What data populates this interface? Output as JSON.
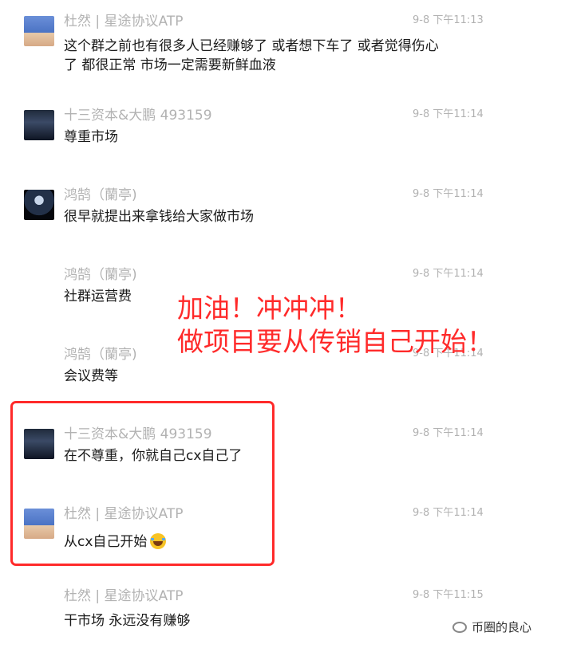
{
  "messages": [
    {
      "sender": "杜然 | 星途协议ATP",
      "time": "9-8 下午11:13",
      "lines": [
        "这个群之前也有很多人已经赚够了 或者想下车了 或者觉得伤心",
        "了 都很正常 市场一定需要新鲜血液"
      ],
      "avatar": "user-photo-avatar"
    },
    {
      "sender": "十三资本&大鹏 493159",
      "time": "9-8 下午11:14",
      "lines": [
        "尊重市场"
      ],
      "avatar": "city-night-avatar"
    },
    {
      "sender": "鸿鹄（蘭亭)",
      "time": "9-8 下午11:14",
      "lines": [
        "很早就提出来拿钱给大家做市场"
      ],
      "avatar": "dark-figure-avatar"
    },
    {
      "sender": "鸿鹄（蘭亭)",
      "time": "9-8 下午11:14",
      "lines": [
        "社群运营费"
      ]
    },
    {
      "sender": "鸿鹄（蘭亭)",
      "time": "9-8 下午11:14",
      "lines": [
        "会议费等"
      ]
    },
    {
      "sender": "十三资本&大鹏 493159",
      "time": "9-8 下午11:14",
      "lines": [
        "在不尊重，你就自己cx自己了"
      ],
      "avatar": "city-night-avatar"
    },
    {
      "sender": "杜然 | 星途协议ATP",
      "time": "9-8 下午11:14",
      "lines": [
        "从cx自己开始"
      ],
      "avatar": "user-photo-avatar",
      "emoji": "laughing-crying-emoji"
    },
    {
      "sender": "杜然 | 星途协议ATP",
      "time": "9-8 下午11:15",
      "lines": [
        "干市场 永远没有赚够"
      ]
    }
  ],
  "overlay": {
    "line1": "加油！冲冲冲！",
    "line2": "做项目要从传销自己开始！",
    "color": "#ff2a2a"
  },
  "watermark": {
    "text": "币圈的良心",
    "icon": "wechat-official-account-icon"
  }
}
